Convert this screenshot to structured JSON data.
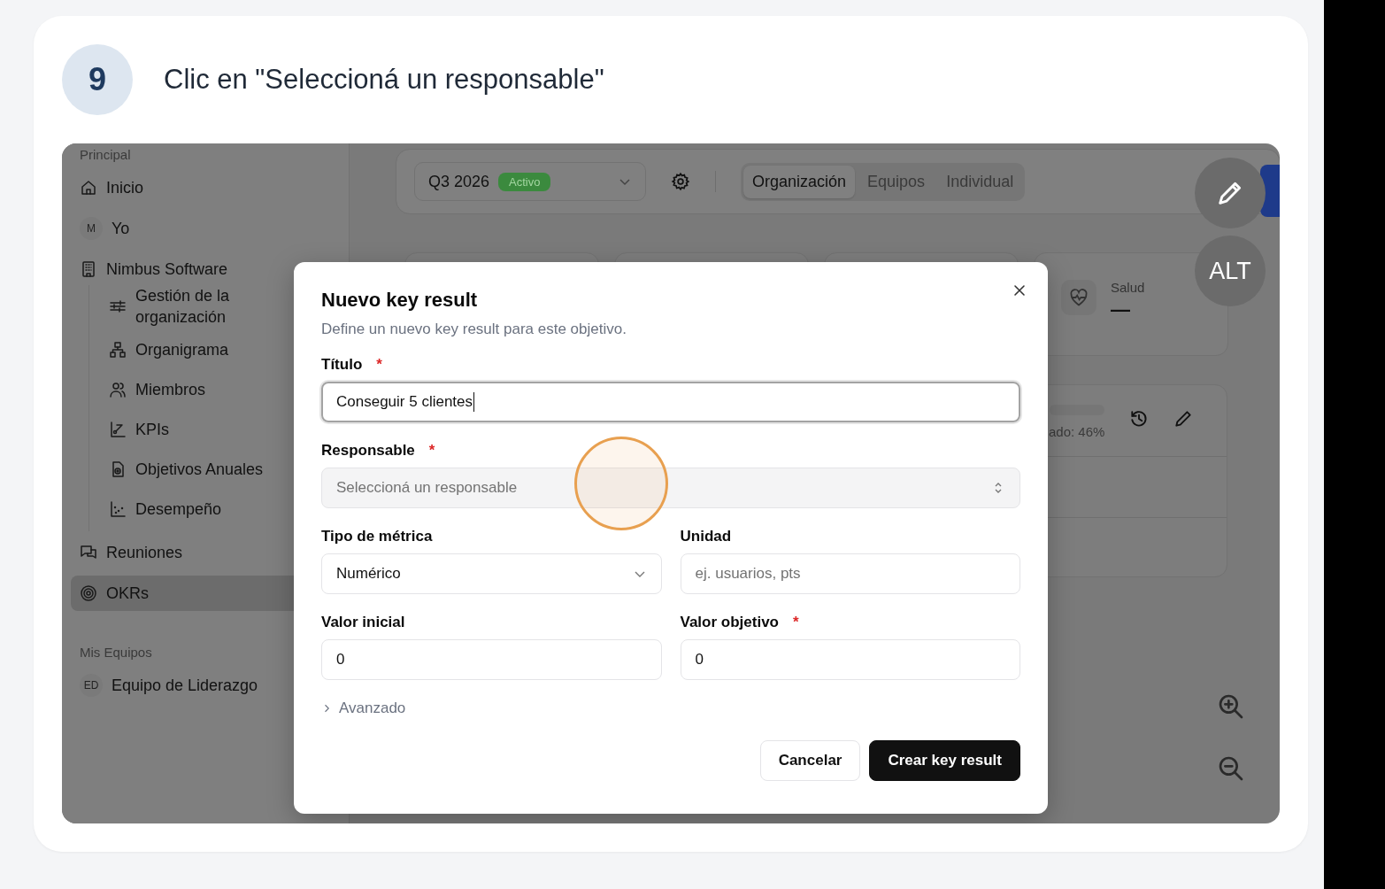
{
  "step": {
    "number": "9",
    "title": "Clic en \"Seleccioná un responsable\""
  },
  "sidebar": {
    "sections": [
      {
        "heading": "Principal",
        "items": [
          {
            "kind": "icon",
            "label": "Inicio",
            "selected": false
          },
          {
            "kind": "avatar",
            "initials": "M",
            "label": "Yo",
            "selected": false
          },
          {
            "kind": "icon",
            "label": "Nimbus Software",
            "selected": false,
            "expanded": true,
            "children": [
              {
                "kind": "icon",
                "label": "Gestión de la organización",
                "selected": false
              },
              {
                "kind": "icon",
                "label": "Organigrama",
                "selected": false
              },
              {
                "kind": "icon",
                "label": "Miembros",
                "selected": false
              },
              {
                "kind": "icon",
                "label": "KPIs",
                "selected": false
              },
              {
                "kind": "icon",
                "label": "Objetivos Anuales",
                "selected": false
              },
              {
                "kind": "icon",
                "label": "Desempeño",
                "selected": false
              }
            ]
          },
          {
            "kind": "icon",
            "label": "Reuniones",
            "selected": false
          },
          {
            "kind": "icon",
            "label": "OKRs",
            "selected": true
          }
        ]
      },
      {
        "heading": "Mis Equipos",
        "items": [
          {
            "kind": "avatar",
            "initials": "ED",
            "label": "Equipo de Liderazgo",
            "selected": false
          }
        ]
      }
    ]
  },
  "topbar": {
    "period": {
      "label": "Q3 2026",
      "badge": "Activo"
    },
    "view_tabs": [
      {
        "label": "Organización",
        "selected": true
      },
      {
        "label": "Equipos",
        "selected": false
      },
      {
        "label": "Individual",
        "selected": false
      }
    ]
  },
  "stat_card": {
    "label": "Salud",
    "value": "—"
  },
  "list_card": {
    "progress_text": "ado: 46%"
  },
  "floating": {
    "alt_label": "ALT"
  },
  "modal": {
    "title": "Nuevo key result",
    "subtitle": "Define un nuevo key result para este objetivo.",
    "rows": [
      [
        {
          "kind": "text",
          "label": "Título",
          "required_mark": "*",
          "value": "Conseguir 5 clientes",
          "focused": true
        }
      ],
      [
        {
          "kind": "combobox",
          "label": "Responsable",
          "required_mark": "*",
          "placeholder": "Seleccioná un responsable",
          "focused": false
        }
      ],
      [
        {
          "kind": "select",
          "label": "Tipo de métrica",
          "value": "Numérico",
          "focused": false
        },
        {
          "kind": "text",
          "label": "Unidad",
          "placeholder": "ej. usuarios, pts",
          "focused": false
        }
      ],
      [
        {
          "kind": "text",
          "label": "Valor inicial",
          "value": "0",
          "focused": false
        },
        {
          "kind": "text",
          "label": "Valor objetivo",
          "required_mark": "*",
          "value": "0",
          "focused": false
        }
      ]
    ],
    "advanced": {
      "label": "Avanzado",
      "expanded": false
    },
    "buttons": [
      {
        "kind": "secondary",
        "label": "Cancelar"
      },
      {
        "kind": "primary",
        "label": "Crear key result"
      }
    ]
  }
}
